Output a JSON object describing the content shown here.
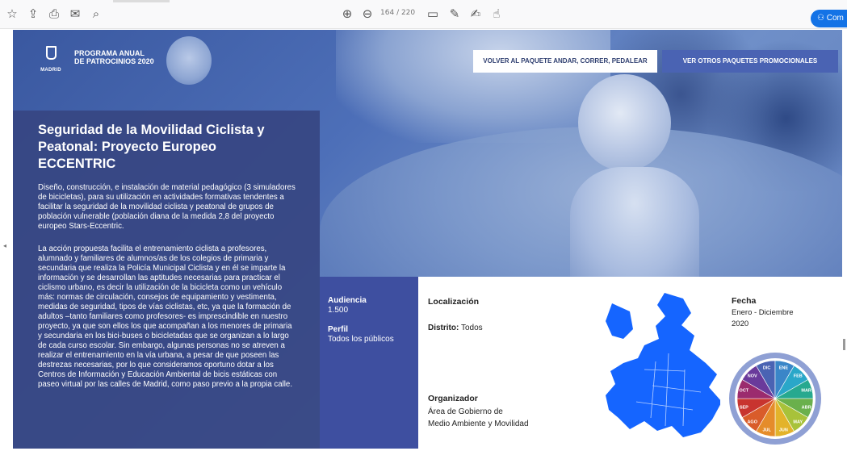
{
  "toolbar": {
    "icons": [
      "star-icon",
      "upload-icon",
      "print-icon",
      "mail-icon",
      "zoom-icon",
      "page-up-icon",
      "page-down-icon",
      "comment-icon",
      "pen-icon",
      "sign-icon",
      "more-tools-icon"
    ],
    "page_current": "164",
    "page_total": "/ 220",
    "comment_label": "Com"
  },
  "header": {
    "logo_text": "MADRID",
    "program_line1": "PROGRAMA ANUAL",
    "program_line2": "DE PATROCINIOS 2020",
    "back_button": "VOLVER AL PAQUETE ANDAR, CORRER, PEDALEAR",
    "other_button": "VER OTROS PAQUETES PROMOCIONALES"
  },
  "content": {
    "title": "Seguridad de la Movilidad Ciclista y Peatonal: Proyecto Europeo ECCENTRIC",
    "paragraph1": "Diseño, construcción, e instalación de material pedagógico (3 simuladores de bicicletas), para su utilización en actividades formativas tendentes a facilitar la seguridad de la movilidad ciclista y peatonal de grupos de población vulnerable (población diana de la medida 2,8 del proyecto europeo Stars-Eccentric.",
    "paragraph2": "La acción propuesta facilita el entrenamiento ciclista a profesores, alumnado y familiares de alumnos/as de los colegios de primaria y secundaria que realiza la Policía Municipal Ciclista y en él se imparte la información y se desarrollan las aptitudes necesarias para practicar el ciclismo urbano, es decir la utilización de la bicicleta como un vehículo más: normas de circulación, consejos de equipamiento y vestimenta, medidas de seguridad, tipos de vías ciclistas, etc, ya que la formación de adultos –tanto familiares como profesores- es imprescindible en nuestro proyecto, ya que son ellos los que acompañan a los menores de primaria y secundaria en los bici-buses o bicicletadas que se organizan a lo largo de cada curso escolar. Sin embargo, algunas personas no se atreven a realizar el entrenamiento en la vía urbana, a pesar de que poseen las destrezas necesarias, por lo que consideramos oportuno dotar a los Centros de Información y Educación Ambiental de bicis estáticas con paseo virtual por las calles de Madrid, como paso previo a la propia calle."
  },
  "info": {
    "audience_label": "Audiencia",
    "audience_value": "1.500",
    "profile_label": "Perfil",
    "profile_value": "Todos los públicos",
    "location_label": "Localización",
    "district_label": "Distrito:",
    "district_value": "Todos",
    "organizer_label": "Organizador",
    "organizer_line1": "Área de Gobierno de",
    "organizer_line2": "Medio Ambiente y Movilidad",
    "date_label": "Fecha",
    "date_line1": "Enero - Diciembre",
    "date_line2": "2020",
    "months": [
      "DIC",
      "ENE",
      "FEB",
      "MAR",
      "ABR",
      "MAY",
      "JUN",
      "JUL",
      "AGO",
      "SEP",
      "OCT",
      "NOV"
    ],
    "month_colors": [
      "#4a63b3",
      "#3a86c8",
      "#2aa7c9",
      "#27a98f",
      "#6ab04c",
      "#a8c23a",
      "#e3b32a",
      "#e58c2a",
      "#d95c2a",
      "#c8342f",
      "#9b2b6e",
      "#6a3a9b"
    ],
    "map_color": "#1565ff"
  }
}
